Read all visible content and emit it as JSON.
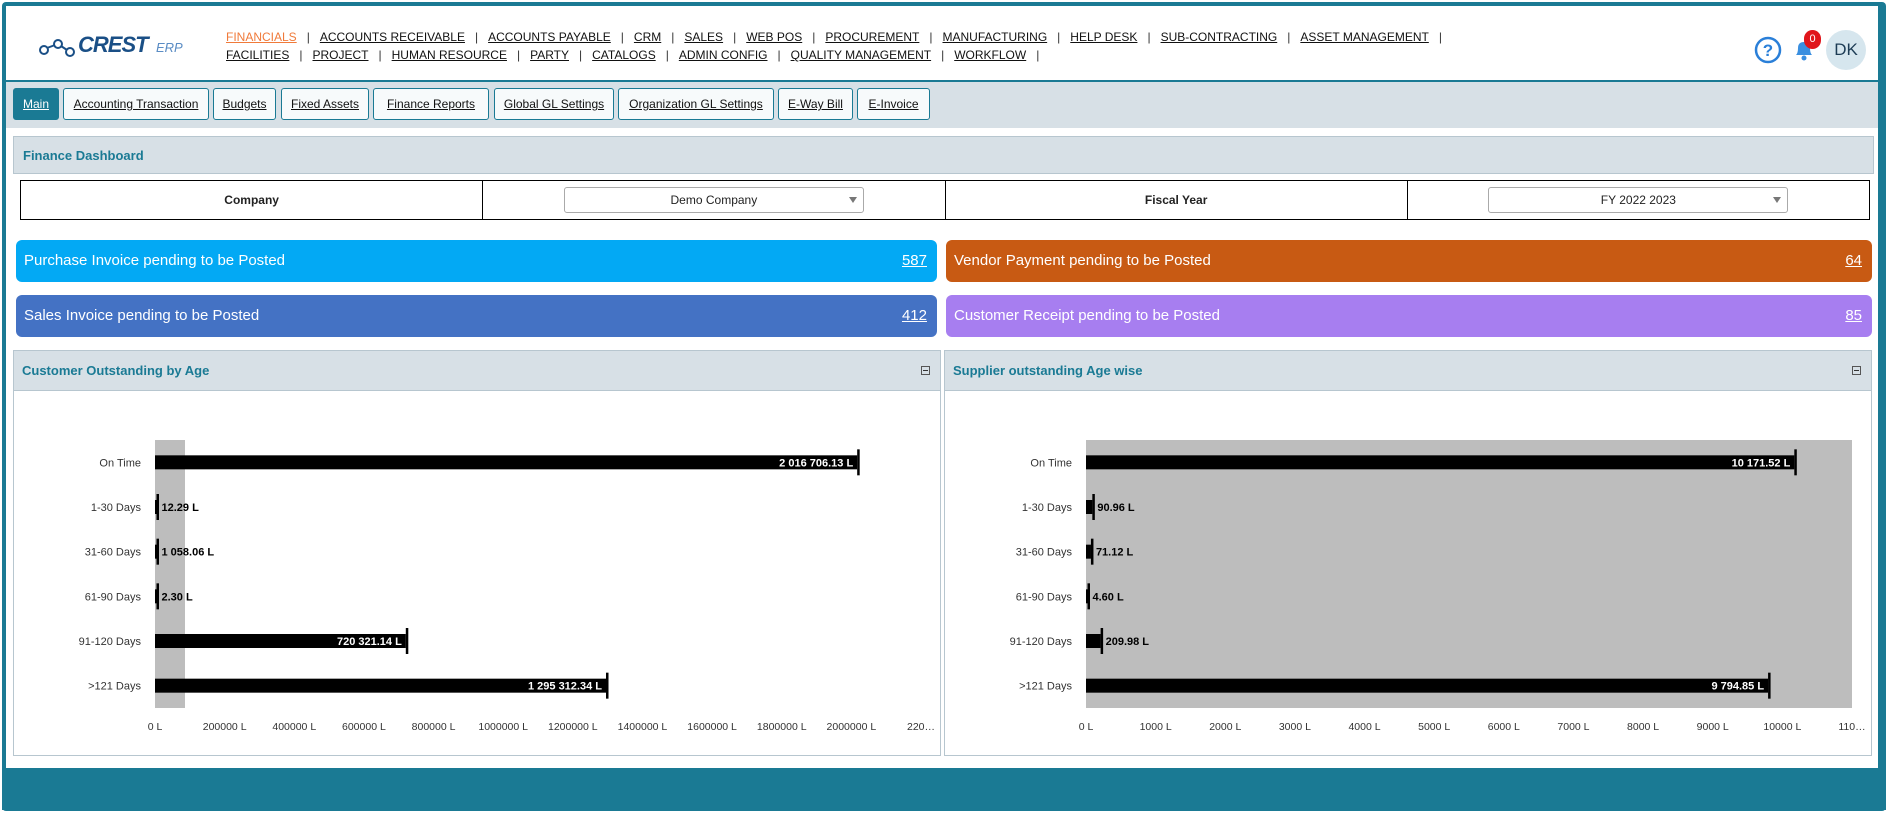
{
  "app": {
    "logo_text": "CREST",
    "logo_suffix": "ERP"
  },
  "nav": {
    "row1": [
      "FINANCIALS",
      "ACCOUNTS RECEIVABLE",
      "ACCOUNTS PAYABLE",
      "CRM",
      "SALES",
      "WEB POS",
      "PROCUREMENT",
      "MANUFACTURING",
      "HELP DESK",
      "SUB-CONTRACTING",
      "ASSET MANAGEMENT"
    ],
    "row2": [
      "FACILITIES",
      "PROJECT",
      "HUMAN RESOURCE",
      "PARTY",
      "CATALOGS",
      "ADMIN CONFIG",
      "QUALITY MANAGEMENT",
      "WORKFLOW"
    ],
    "active": "FINANCIALS"
  },
  "header": {
    "notification_count": "0",
    "user_initials": "DK"
  },
  "tabs": [
    "Main",
    "Accounting Transaction",
    "Budgets",
    "Fixed Assets",
    "Finance Reports",
    "Global GL Settings",
    "Organization GL Settings",
    "E-Way Bill",
    "E-Invoice"
  ],
  "dashboard": {
    "title": "Finance Dashboard",
    "company_label": "Company",
    "company_value": "Demo Company",
    "fiscal_label": "Fiscal Year",
    "fiscal_value": "FY 2022 2023"
  },
  "cards": [
    {
      "label": "Purchase Invoice pending to be Posted",
      "value": "587",
      "color": "#03a9f4"
    },
    {
      "label": "Vendor Payment pending to be Posted",
      "value": "64",
      "color": "#c85a13"
    },
    {
      "label": "Sales Invoice pending to be Posted",
      "value": "412",
      "color": "#4472c4"
    },
    {
      "label": "Customer Receipt pending to be Posted",
      "value": "85",
      "color": "#a77ef0"
    }
  ],
  "chart_data": [
    {
      "type": "bar",
      "orientation": "horizontal",
      "title": "Customer Outstanding by Age",
      "categories": [
        "On Time",
        "1-30 Days",
        "31-60 Days",
        "61-90 Days",
        "91-120 Days",
        ">121 Days"
      ],
      "values": [
        2016706.13,
        12.29,
        1058.06,
        2.3,
        720321.14,
        1295312.34
      ],
      "labels": [
        "2 016 706.13 L",
        "12.29 L",
        "1 058.06 L",
        "2.30 L",
        "720 321.14 L",
        "1 295 312.34 L"
      ],
      "xlim": [
        0,
        2200000
      ],
      "ticks": [
        "0 L",
        "200000 L",
        "400000 L",
        "600000 L",
        "800000 L",
        "1000000 L",
        "1200000 L",
        "1400000 L",
        "1600000 L",
        "1800000 L",
        "2000000 L",
        "220…"
      ],
      "bar_color": "#000000",
      "grid": false
    },
    {
      "type": "bar",
      "orientation": "horizontal",
      "title": "Supplier outstanding Age wise",
      "categories": [
        "On Time",
        "1-30 Days",
        "31-60 Days",
        "61-90 Days",
        "91-120 Days",
        ">121 Days"
      ],
      "values": [
        10171.52,
        90.96,
        71.12,
        4.6,
        209.98,
        9794.85
      ],
      "labels": [
        "10 171.52 L",
        "90.96 L",
        "71.12 L",
        "4.60 L",
        "209.98 L",
        "9 794.85 L"
      ],
      "xlim": [
        0,
        11000
      ],
      "ticks": [
        "0 L",
        "1000 L",
        "2000 L",
        "3000 L",
        "4000 L",
        "5000 L",
        "6000 L",
        "7000 L",
        "8000 L",
        "9000 L",
        "10000 L",
        "110…"
      ],
      "bar_color": "#000000",
      "grid": false
    }
  ]
}
